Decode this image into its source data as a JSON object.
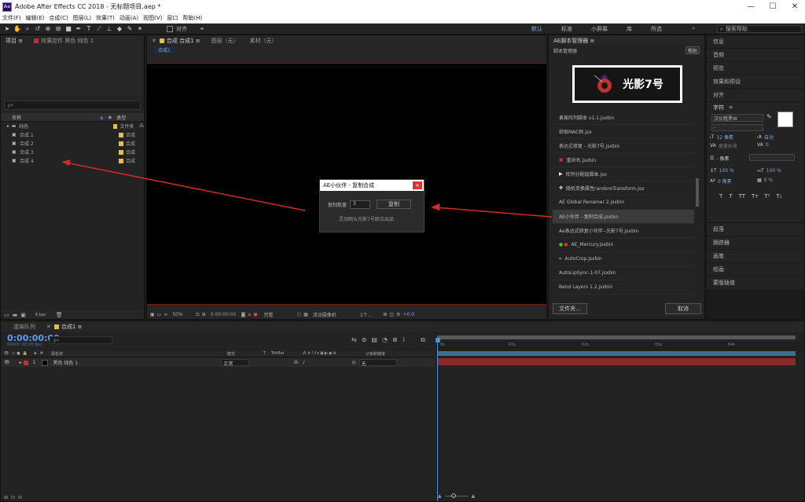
{
  "window": {
    "app_logo": "Ae",
    "title": "Adobe After Effects CC 2018 - 无标题项目.aep *",
    "min": "—",
    "max": "☐",
    "close": "✕"
  },
  "menu": [
    "文件(F)",
    "编辑(E)",
    "合成(C)",
    "图层(L)",
    "效果(T)",
    "动画(A)",
    "视图(V)",
    "窗口",
    "帮助(H)"
  ],
  "toolbar": {
    "align": "对齐",
    "workspaces": [
      "默认",
      "标准",
      "小屏幕",
      "库",
      "所选"
    ],
    "search_placeholder": "搜索帮助"
  },
  "project": {
    "tabs": [
      "项目",
      "效果控件 黑色 纯色 1"
    ],
    "search_placeholder": "ρ•",
    "headers": {
      "name": "名称",
      "type": "类型"
    },
    "items": [
      {
        "name": "纯色",
        "type": "文件夹",
        "color": "#e0c24a"
      },
      {
        "name": "合成 1",
        "type": "合成",
        "color": "#e0c24a"
      },
      {
        "name": "合成 2",
        "type": "合成",
        "color": "#e0c24a"
      },
      {
        "name": "合成 3",
        "type": "合成",
        "color": "#e0c24a"
      },
      {
        "name": "合成 4",
        "type": "合成",
        "color": "#e0c24a"
      }
    ],
    "bpc": "8 bpc"
  },
  "viewer": {
    "tabs": [
      "合成 合成1",
      "图层（无）",
      "素材（无）"
    ],
    "subtab": "合成1",
    "zoom": "50%",
    "timecode": "0:00:00:00",
    "quality": "完整",
    "camera": "活动摄像机",
    "views": "1个...",
    "exposure": "+0.0"
  },
  "dialog": {
    "title": "AE小伙伴 - 复制合成",
    "close": "✕",
    "count_label": "复制数量",
    "count_value": "3",
    "copy_button": "复制",
    "credit": "灵动网＆光影7号联合出品"
  },
  "scripts": {
    "panel_title": "AE脚本管理器",
    "subtitle": "脚本管理器",
    "help": "帮助",
    "logo_text": "光影7号",
    "items": [
      "黄易阵列脚本 v1.1.jsxbin",
      "获取MAC码.jsx",
      "表达式修复 - 光影7号.jsxbin",
      "重命名.jsxbin",
      "阵列分配层脚本.jsx",
      "随机变换属性randomTransform.jsx",
      "AE Global Renamer 2.jsxbin",
      "AE小伙伴 - 复制合成.jsxbin",
      "Ae表达式修复小伙伴--光影7号.jsxbin",
      "AE_Mercury.jsxbin",
      "AutoCrop.jsxbin",
      "AutoLipSync-1-07.jsxbin",
      "Bend Layers 1.2.jsxbin"
    ],
    "folder_button": "文件夹...",
    "cancel_button": "取消"
  },
  "right": {
    "panels_top": [
      "信息",
      "音频",
      "预览",
      "效果和预设",
      "对齐"
    ],
    "char_title": "字符",
    "font": "汉仪粗黑W",
    "size": "12 像素",
    "leading": "自动",
    "tracking_label": "度量标准",
    "tracking": "0",
    "stroke": "- 像素",
    "v_scale": "100 %",
    "h_scale": "100 %",
    "baseline": "0 像素",
    "tsume": "0 %",
    "styles": [
      "T",
      "T",
      "TT",
      "Tт",
      "T¹",
      "T₁"
    ],
    "panels_bottom": [
      "段落",
      "跟踪器",
      "画笔",
      "绘画",
      "蒙版插值"
    ]
  },
  "timeline": {
    "tabs": [
      "渲染队列",
      "合成1"
    ],
    "timecode": "0:00:00:00",
    "fps": "00000 (30.00 fps)",
    "search_placeholder": "ρ•",
    "headers": {
      "num": "#",
      "source": "源名称",
      "mode": "模式",
      "t": "T",
      "trkmat": "TrkMat",
      "parent": "父级和链接"
    },
    "layer": {
      "num": "1",
      "name": "黑色 纯色 1",
      "mode": "正常",
      "parent": "无",
      "color": "#c03030"
    },
    "ruler": [
      "0s",
      "01s",
      "02s",
      "03s",
      "04s"
    ]
  }
}
